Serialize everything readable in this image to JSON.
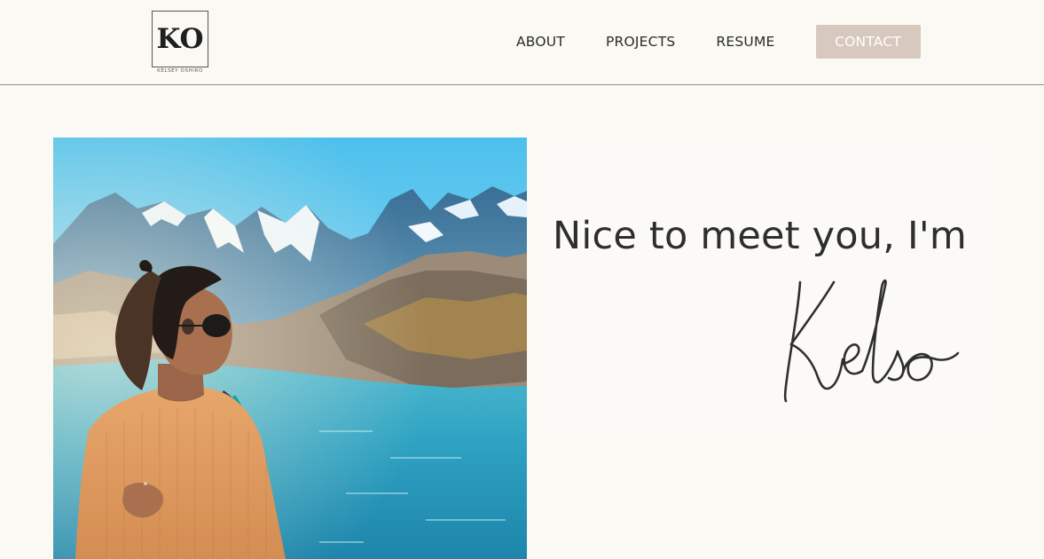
{
  "header": {
    "logo": {
      "monogram": "KO",
      "subtitle": "KELSEY OSHIRO"
    },
    "nav": {
      "about": "ABOUT",
      "projects": "PROJECTS",
      "resume": "RESUME",
      "contact": "CONTACT"
    }
  },
  "hero": {
    "greeting": "Nice to meet you, I'm",
    "signature_name": "Kelso"
  },
  "colors": {
    "background": "#faf9f4",
    "contact_button": "#d8c9bf",
    "text": "#2b2b2b"
  }
}
